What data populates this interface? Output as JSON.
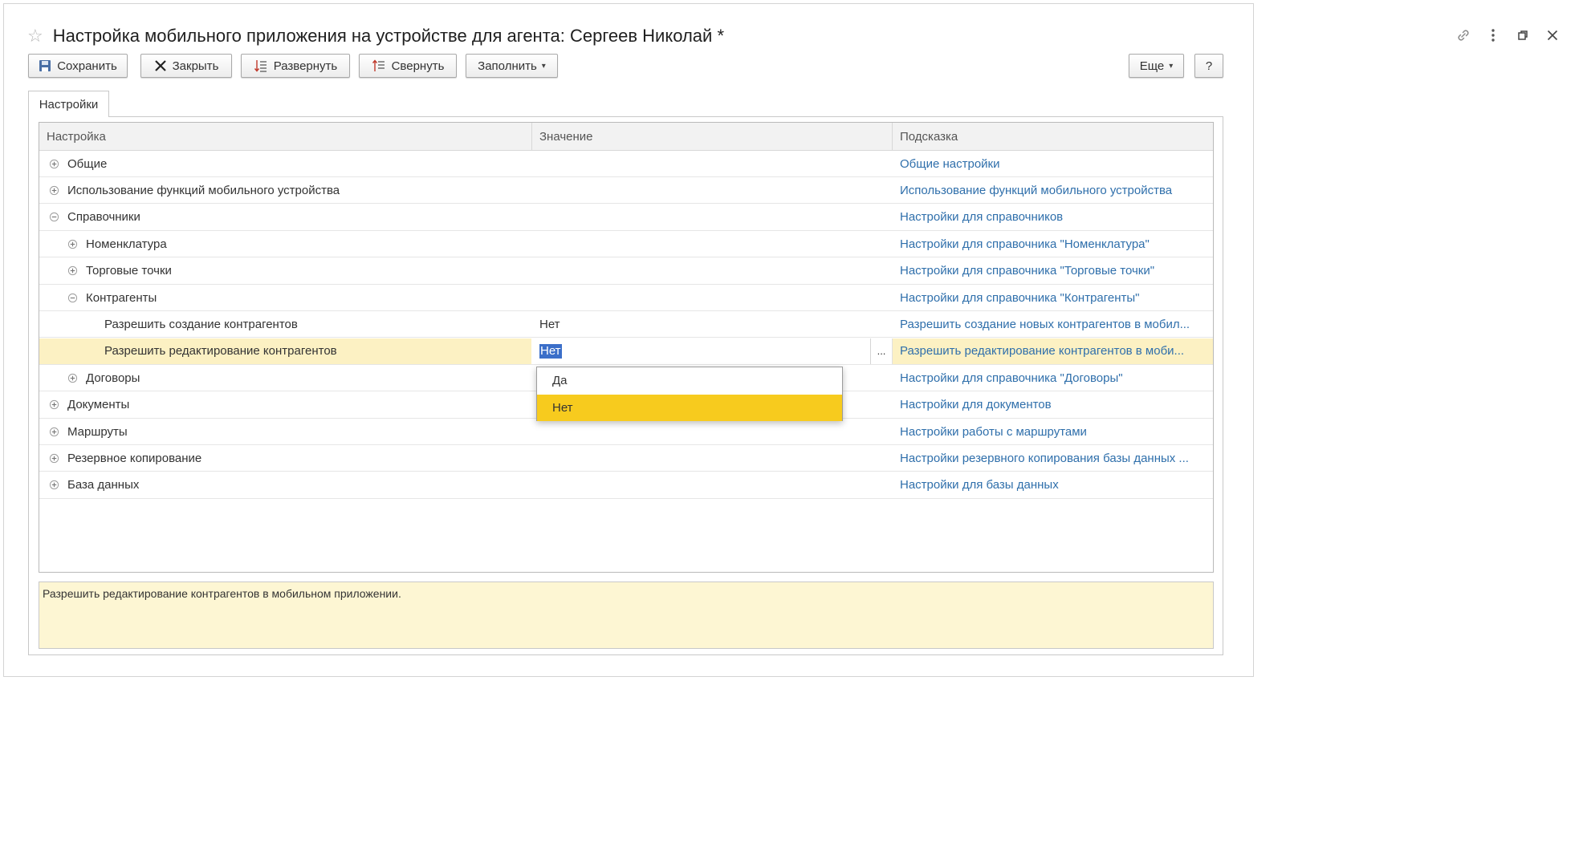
{
  "window": {
    "title": "Настройка мобильного приложения на устройстве для агента: Сергеев Николай *"
  },
  "toolbar": {
    "save_label": "Сохранить",
    "close_label": "Закрыть",
    "expand_label": "Развернуть",
    "collapse_label": "Свернуть",
    "fill_label": "Заполнить",
    "more_label": "Еще",
    "help_label": "?"
  },
  "tabs": [
    {
      "label": "Настройки"
    }
  ],
  "grid": {
    "columns": [
      "Настройка",
      "Значение",
      "Подсказка"
    ],
    "rows": [
      {
        "name": "Общие",
        "value": "",
        "hint": "Общие настройки"
      },
      {
        "name": "Использование функций мобильного устройства",
        "value": "",
        "hint": "Использование функций мобильного устройства"
      },
      {
        "name": "Справочники",
        "value": "",
        "hint": "Настройки для справочников"
      },
      {
        "name": "Номенклатура",
        "value": "",
        "hint": "Настройки для справочника \"Номенклатура\""
      },
      {
        "name": "Торговые точки",
        "value": "",
        "hint": "Настройки для справочника \"Торговые точки\""
      },
      {
        "name": "Контрагенты",
        "value": "",
        "hint": "Настройки для справочника \"Контрагенты\""
      },
      {
        "name": "Разрешить создание контрагентов",
        "value": "Нет",
        "hint": "Разрешить создание новых контрагентов в мобил..."
      },
      {
        "name": "Разрешить редактирование контрагентов",
        "value": "Нет",
        "hint": "Разрешить редактирование контрагентов в моби..."
      },
      {
        "name": "Договоры",
        "value": "",
        "hint": "Настройки для справочника \"Договоры\""
      },
      {
        "name": "Документы",
        "value": "",
        "hint": "Настройки для документов"
      },
      {
        "name": "Маршруты",
        "value": "",
        "hint": "Настройки работы с маршрутами"
      },
      {
        "name": "Резервное копирование",
        "value": "",
        "hint": "Настройки резервного копирования базы данных ..."
      },
      {
        "name": "База данных",
        "value": "",
        "hint": "Настройки для базы данных"
      }
    ]
  },
  "dropdown": {
    "options": [
      "Да",
      "Нет"
    ],
    "selected": "Нет"
  },
  "hint_panel": {
    "text": "Разрешить редактирование контрагентов в мобильном приложении."
  },
  "colors": {
    "link": "#2f6fab",
    "selected_row": "#fcf1c3",
    "dropdown_active": "#f7cb1e",
    "hint_bg": "#fdf6d3"
  }
}
